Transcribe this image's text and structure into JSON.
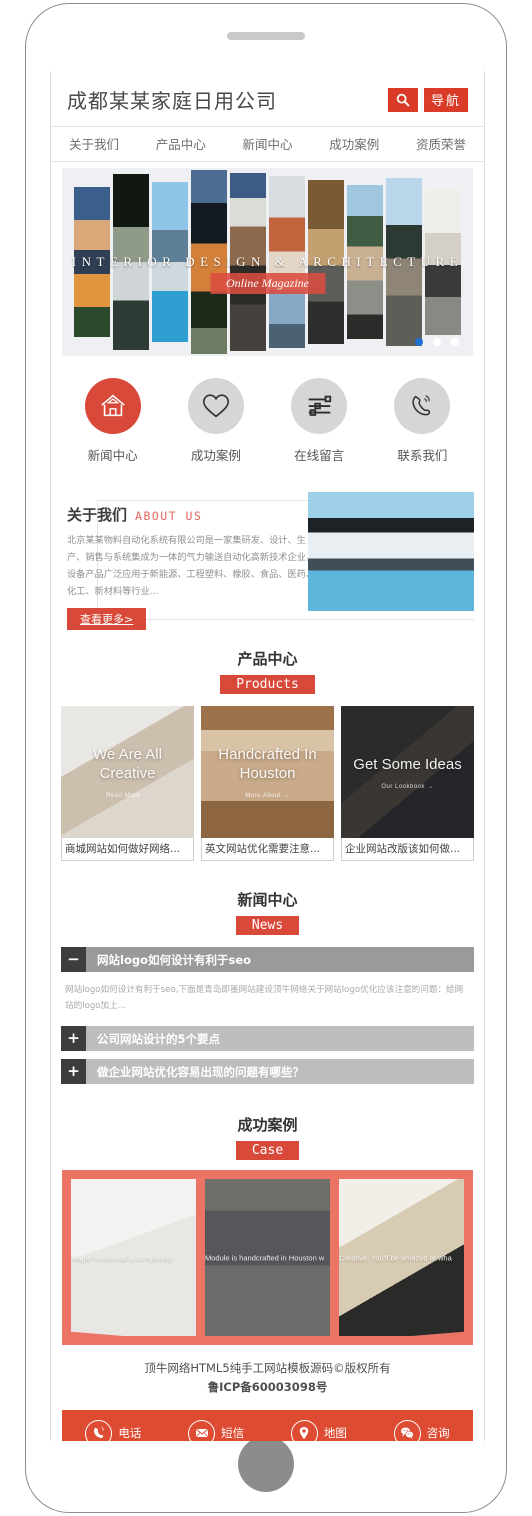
{
  "device": {
    "frame": "phone-mockup"
  },
  "header": {
    "site_title": "成都某某家庭日用公司",
    "search_icon": "search-icon",
    "nav_button_label": "导航",
    "accent_color": "#d93b28"
  },
  "nav": {
    "items": [
      {
        "label": "关于我们"
      },
      {
        "label": "产品中心"
      },
      {
        "label": "新闻中心"
      },
      {
        "label": "成功案例"
      },
      {
        "label": "资质荣誉"
      }
    ]
  },
  "carousel": {
    "banner_text": "INTERIOR DESIGN & ARCHITECTURE",
    "badge_text": "Online Magazine",
    "slide_count": 3,
    "active_slide": 1,
    "active_dot_color": "#1d72d0"
  },
  "quick_links": {
    "items": [
      {
        "label": "新闻中心",
        "icon": "home-icon",
        "active": true
      },
      {
        "label": "成功案例",
        "icon": "heart-icon",
        "active": false
      },
      {
        "label": "在线留言",
        "icon": "sliders-icon",
        "active": false
      },
      {
        "label": "联系我们",
        "icon": "phone-handset-icon",
        "active": false
      }
    ]
  },
  "about": {
    "title_cn": "关于我们",
    "title_en": "ABOUT US",
    "body": "北京某某物料自动化系统有限公司是一家集研发、设计、生产、销售与系统集成为一体的气力输送自动化高新技术企业，设备产品广泛应用于新能源、工程塑料、橡胶、食品、医药、化工、新材料等行业...",
    "button_label": "查看更多>"
  },
  "products": {
    "title_cn": "产品中心",
    "title_en": "Products",
    "cards": [
      {
        "overlay_title": "We Are All Creative",
        "overlay_sub": "Read More →",
        "caption": "商城网站如何做好网络..."
      },
      {
        "overlay_title": "Handcrafted In Houston",
        "overlay_sub": "More About →",
        "caption": "英文网站优化需要注意..."
      },
      {
        "overlay_title": "Get Some Ideas",
        "overlay_sub": "Our Lookbook →",
        "caption": "企业网站改版该如何做..."
      }
    ]
  },
  "news": {
    "title_cn": "新闻中心",
    "title_en": "News",
    "items": [
      {
        "icon": "minus-icon",
        "title": "网站logo如何设计有利于seo",
        "open": true,
        "body": "网站logo如何设计有利于seo,下面是青岛即墨网站建设顶牛网络关于网站logo优化应该注意的问题：给网站的logo加上..."
      },
      {
        "icon": "plus-icon",
        "title": "公司网站设计的5个要点",
        "open": false,
        "body": ""
      },
      {
        "icon": "plus-icon",
        "title": "做企业网站优化容易出现的问题有哪些？",
        "open": false,
        "body": ""
      }
    ]
  },
  "cases": {
    "title_cn": "成功案例",
    "title_en": "Case",
    "band_color": "#ec7464",
    "cards": [
      {
        "caption": "Maple hardwood is completely"
      },
      {
        "caption": "Module is handcrafted in Houston w"
      },
      {
        "caption": "Creative. You'll be amazed at wha"
      }
    ]
  },
  "copyright": {
    "line1": "顶牛网络HTML5纯手工网站模板源码©版权所有",
    "line2": "鲁ICP备60003098号"
  },
  "bottom_bar": {
    "background": "#de4b33",
    "items": [
      {
        "label": "电话",
        "icon": "phone-handset-icon"
      },
      {
        "label": "短信",
        "icon": "envelope-icon"
      },
      {
        "label": "地图",
        "icon": "map-pin-icon"
      },
      {
        "label": "咨询",
        "icon": "wechat-icon"
      }
    ]
  }
}
